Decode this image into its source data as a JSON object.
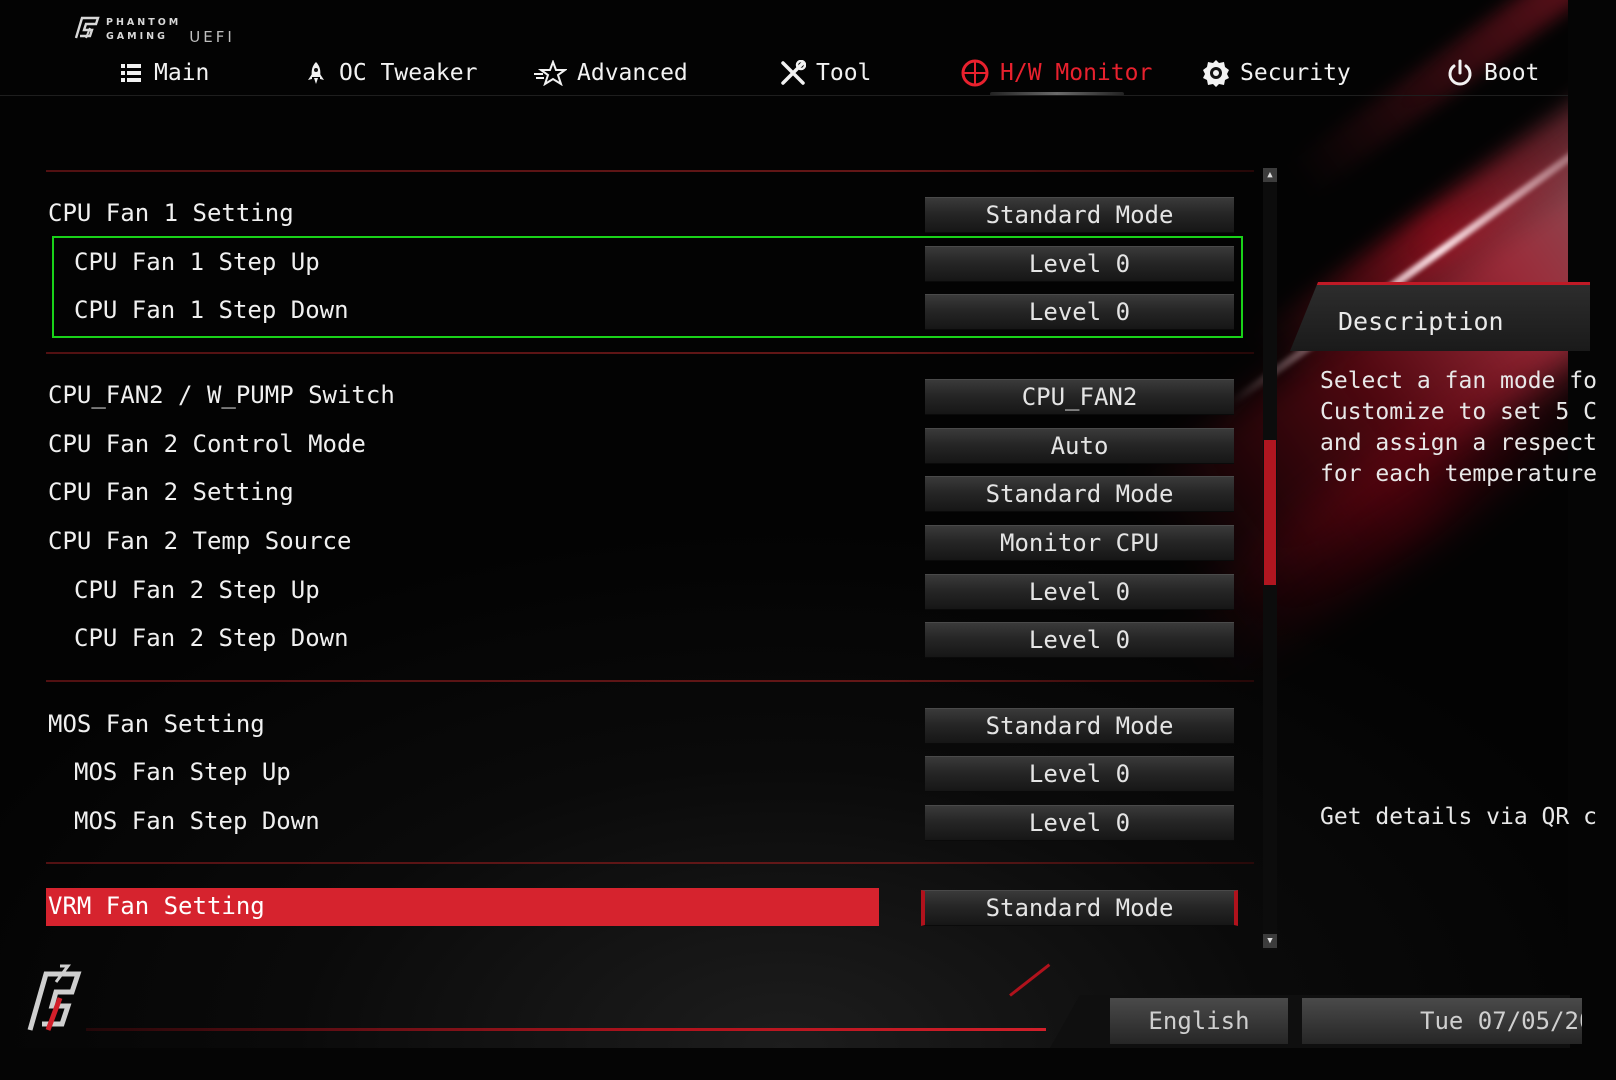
{
  "brand": {
    "line1": "PHANTOM",
    "line2": "GAMING",
    "product": "UEFI"
  },
  "nav": {
    "tabs": [
      {
        "label": "Main",
        "icon": "list-icon"
      },
      {
        "label": "OC Tweaker",
        "icon": "rocket-icon"
      },
      {
        "label": "Advanced",
        "icon": "star-icon"
      },
      {
        "label": "Tool",
        "icon": "tools-icon"
      },
      {
        "label": "H/W Monitor",
        "icon": "monitor-gauge-icon",
        "active": true
      },
      {
        "label": "Security",
        "icon": "shield-badge-icon"
      },
      {
        "label": "Boot",
        "icon": "power-icon"
      }
    ]
  },
  "settings": [
    {
      "label": "CPU Fan 1 Setting",
      "value": "Standard Mode"
    },
    {
      "label": "CPU Fan 1 Step Up",
      "value": "Level 0"
    },
    {
      "label": "CPU Fan 1 Step Down",
      "value": "Level 0"
    },
    {
      "label": "CPU_FAN2 / W_PUMP Switch",
      "value": "CPU_FAN2"
    },
    {
      "label": "CPU Fan 2 Control Mode",
      "value": "Auto"
    },
    {
      "label": "CPU Fan 2 Setting",
      "value": "Standard Mode"
    },
    {
      "label": "CPU Fan 2 Temp Source",
      "value": "Monitor CPU"
    },
    {
      "label": "CPU Fan 2 Step Up",
      "value": "Level 0"
    },
    {
      "label": "CPU Fan 2 Step Down",
      "value": "Level 0"
    },
    {
      "label": "MOS Fan Setting",
      "value": "Standard Mode"
    },
    {
      "label": "MOS Fan Step Up",
      "value": "Level 0"
    },
    {
      "label": "MOS Fan Step Down",
      "value": "Level 0"
    },
    {
      "label": "VRM Fan Setting",
      "value": "Standard Mode",
      "selected": true
    }
  ],
  "description": {
    "title": "Description",
    "body": "Select a fan mode fo\nCustomize to set 5 C\nand assign a respect\nfor each temperature",
    "qr": "Get details via QR c"
  },
  "footer": {
    "language": "English",
    "datetime": "Tue 07/05/20"
  },
  "colors": {
    "accent": "#d6232e",
    "active_tab": "#e8212e",
    "focus_outline": "#19d219",
    "background": "#050505"
  }
}
